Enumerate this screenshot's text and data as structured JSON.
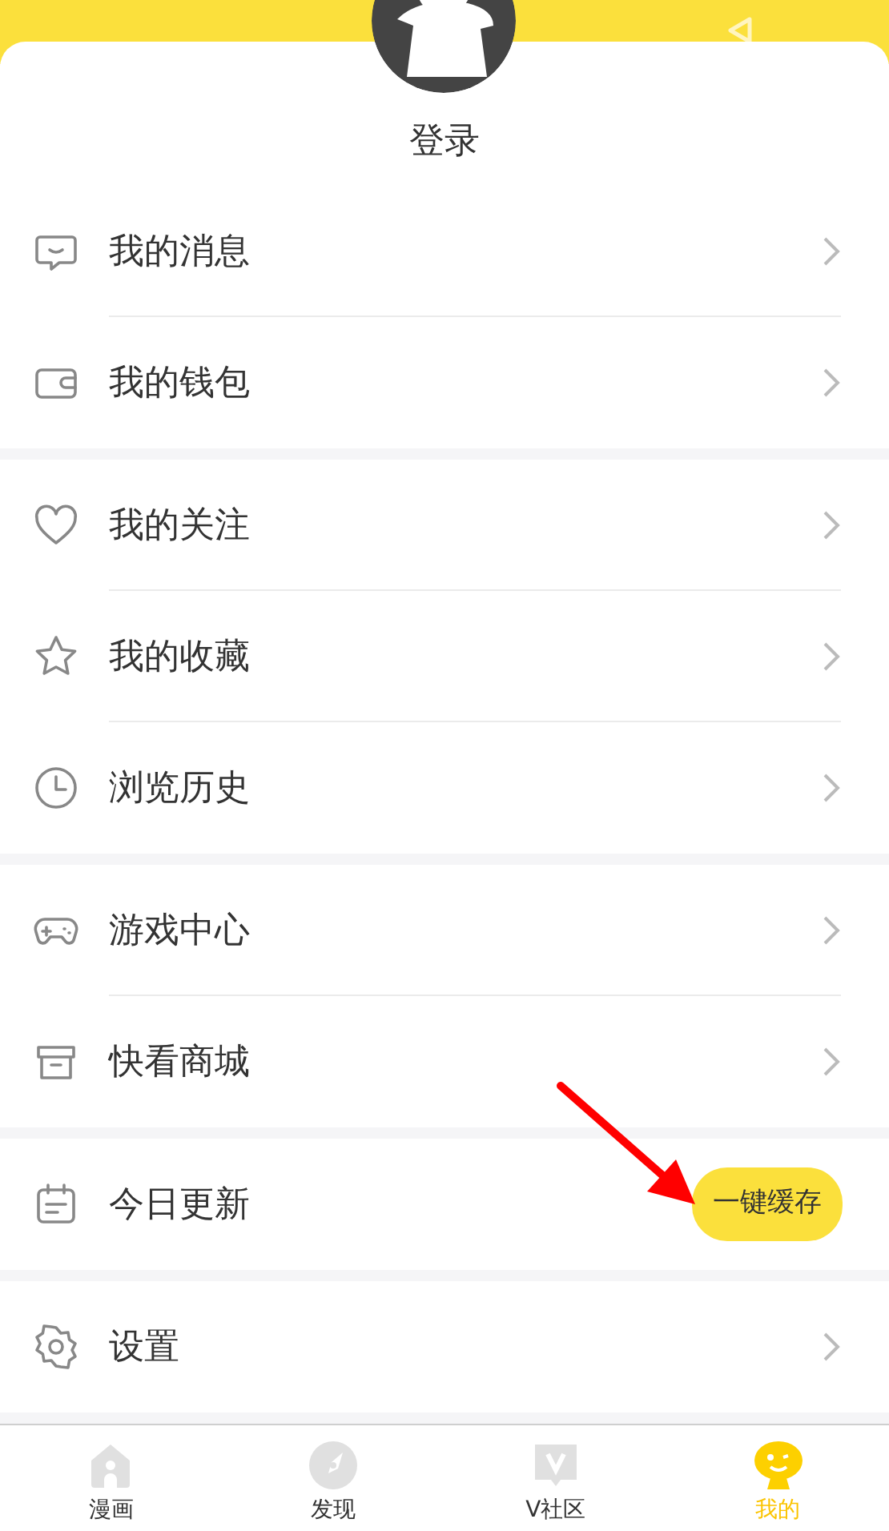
{
  "header": {
    "login": "登录"
  },
  "groups": [
    {
      "items": [
        {
          "kind": "link",
          "label": "我的消息"
        },
        {
          "kind": "link",
          "label": "我的钱包"
        }
      ]
    },
    {
      "items": [
        {
          "kind": "link",
          "label": "我的关注"
        },
        {
          "kind": "link",
          "label": "我的收藏"
        },
        {
          "kind": "link",
          "label": "浏览历史"
        }
      ]
    },
    {
      "items": [
        {
          "kind": "link",
          "label": "游戏中心"
        },
        {
          "kind": "link",
          "label": "快看商城"
        }
      ]
    },
    {
      "items": [
        {
          "kind": "button",
          "label": "今日更新",
          "button": "一键缓存"
        }
      ]
    },
    {
      "items": [
        {
          "kind": "link",
          "label": "设置"
        }
      ]
    }
  ],
  "tabs": [
    {
      "label": "漫画",
      "selected": false
    },
    {
      "label": "发现",
      "selected": false
    },
    {
      "label": "V社区",
      "selected": false
    },
    {
      "label": "我的",
      "selected": true
    }
  ]
}
